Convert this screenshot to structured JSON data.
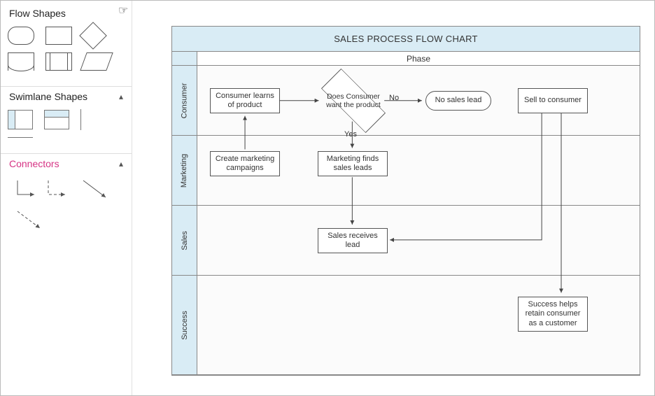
{
  "sidebar": {
    "flow_title": "Flow Shapes",
    "swimlane_title": "Swimlane Shapes",
    "connectors_title": "Connectors"
  },
  "chart": {
    "title": "SALES PROCESS FLOW CHART",
    "phase_label": "Phase",
    "lanes": {
      "consumer": "Consumer",
      "marketing": "Marketing",
      "sales": "Sales",
      "success": "Success"
    }
  },
  "nodes": {
    "consumer_learns": "Consumer learns of product",
    "decision": "Does Consumer want the product",
    "no_lead": "No sales lead",
    "sell_consumer": "Sell to consumer",
    "create_campaigns": "Create marketing campaigns",
    "marketing_finds": "Marketing finds sales leads",
    "sales_receives": "Sales receives lead",
    "success_retain": "Success helps retain consumer as a customer"
  },
  "edge_labels": {
    "no": "No",
    "yes": "Yes"
  },
  "chart_data": {
    "type": "swimlane-flowchart",
    "title": "SALES PROCESS FLOW CHART",
    "phase_header": "Phase",
    "lanes": [
      "Consumer",
      "Marketing",
      "Sales",
      "Success"
    ],
    "nodes": [
      {
        "id": "n1",
        "lane": "Consumer",
        "type": "process",
        "text": "Consumer learns of product"
      },
      {
        "id": "n2",
        "lane": "Consumer",
        "type": "decision",
        "text": "Does Consumer want the product"
      },
      {
        "id": "n3",
        "lane": "Consumer",
        "type": "terminator",
        "text": "No sales lead"
      },
      {
        "id": "n4",
        "lane": "Consumer",
        "type": "process",
        "text": "Sell to consumer"
      },
      {
        "id": "n5",
        "lane": "Marketing",
        "type": "process",
        "text": "Create marketing campaigns"
      },
      {
        "id": "n6",
        "lane": "Marketing",
        "type": "process",
        "text": "Marketing finds sales leads"
      },
      {
        "id": "n7",
        "lane": "Sales",
        "type": "process",
        "text": "Sales receives lead"
      },
      {
        "id": "n8",
        "lane": "Success",
        "type": "process",
        "text": "Success helps retain consumer as a customer"
      }
    ],
    "edges": [
      {
        "from": "n1",
        "to": "n2"
      },
      {
        "from": "n2",
        "to": "n3",
        "label": "No"
      },
      {
        "from": "n2",
        "to": "n6",
        "label": "Yes"
      },
      {
        "from": "n5",
        "to": "n1"
      },
      {
        "from": "n6",
        "to": "n7"
      },
      {
        "from": "n7",
        "to": "n4"
      },
      {
        "from": "n4",
        "to": "n7"
      },
      {
        "from": "n4",
        "to": "n8"
      }
    ]
  }
}
